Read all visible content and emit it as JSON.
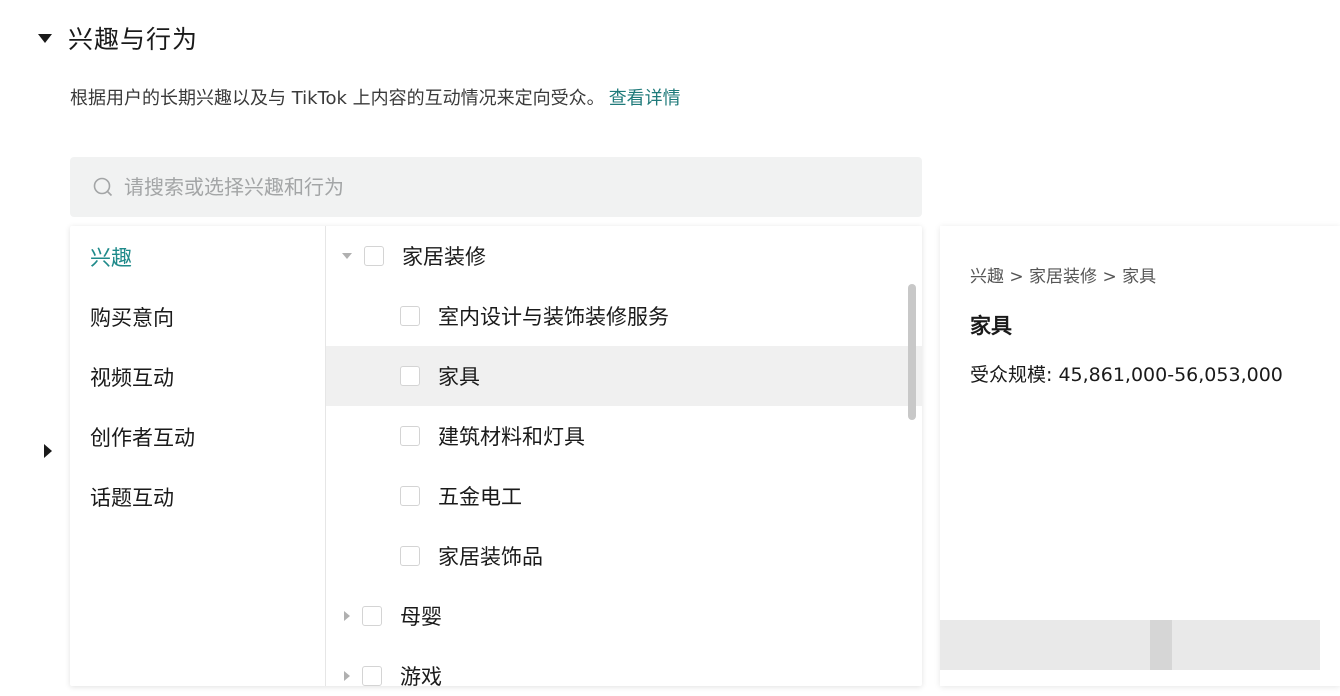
{
  "section": {
    "title": "兴趣与行为"
  },
  "description": {
    "text": "根据用户的长期兴趣以及与 TikTok 上内容的互动情况来定向受众。",
    "link": "查看详情"
  },
  "search": {
    "placeholder": "请搜索或选择兴趣和行为"
  },
  "categories": [
    "兴趣",
    "购买意向",
    "视频互动",
    "创作者互动",
    "话题互动"
  ],
  "tree": [
    {
      "label": "家居装修"
    },
    {
      "label": "室内设计与装饰装修服务"
    },
    {
      "label": "家具"
    },
    {
      "label": "建筑材料和灯具"
    },
    {
      "label": "五金电工"
    },
    {
      "label": "家居装饰品"
    },
    {
      "label": "母婴"
    },
    {
      "label": "游戏"
    }
  ],
  "detail": {
    "breadcrumb": "兴趣 > 家居装修 > 家具",
    "title": "家具",
    "audience_size": "受众规模: 45,861,000-56,053,000"
  },
  "colors": {
    "accent": "#1f8a8a",
    "link": "#1f7a7a"
  }
}
